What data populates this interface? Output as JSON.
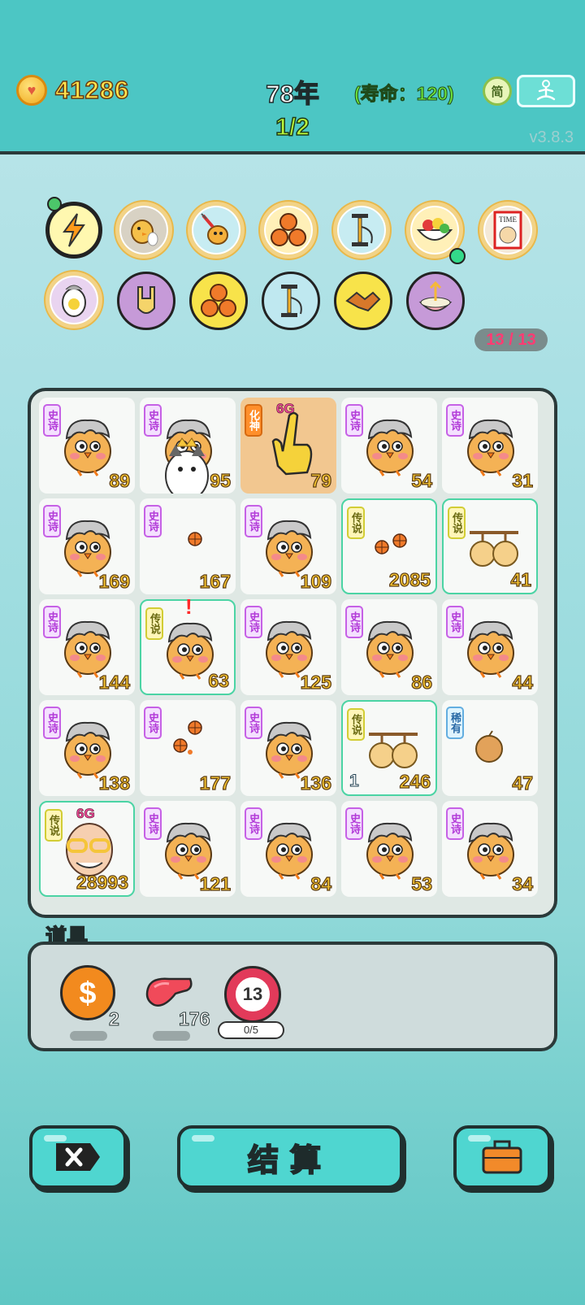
{
  "header": {
    "coins": "41286",
    "year": "78年",
    "lifespan": "(寿命：120)",
    "round": "1/2",
    "simplified_icon_label": "简",
    "version": "v3.8.3"
  },
  "buffs": {
    "count": "13 / 13",
    "row1": [
      "lightning-icon",
      "chick-egg-icon",
      "syringe-chick-icon",
      "basketballs-icon",
      "pump-icon",
      "fruit-bowl-icon",
      "time-magazine-icon"
    ],
    "row2": [
      "egg-head-icon",
      "rock-hand-icon",
      "basketballs-icon",
      "pump-icon",
      "handshake-icon",
      "upgrade-bowl-icon"
    ]
  },
  "board": {
    "cells": [
      {
        "tag": "史诗",
        "value": "89",
        "icon": "chicken-guy-icon"
      },
      {
        "tag": "史诗",
        "value": "95",
        "icon": "chicken-guy-husky-icon"
      },
      {
        "tag": "化神",
        "value": "79",
        "icon": "pointing-hand-icon",
        "badge": "6G"
      },
      {
        "tag": "史诗",
        "value": "54",
        "icon": "chicken-guy-icon"
      },
      {
        "tag": "史诗",
        "value": "31",
        "icon": "chicken-guy-icon"
      },
      {
        "tag": "史诗",
        "value": "169",
        "icon": "chicken-guy-icon"
      },
      {
        "tag": "史诗",
        "value": "167",
        "icon": "basketball-icon"
      },
      {
        "tag": "史诗",
        "value": "109",
        "icon": "chicken-guy-icon"
      },
      {
        "tag": "传说",
        "value": "2085",
        "icon": "basketball-icon"
      },
      {
        "tag": "传说",
        "value": "41",
        "icon": "gourd-icon"
      },
      {
        "tag": "史诗",
        "value": "144",
        "icon": "chicken-guy-icon"
      },
      {
        "tag": "传说",
        "value": "63",
        "icon": "chicken-guy-icon",
        "alert": "!"
      },
      {
        "tag": "史诗",
        "value": "125",
        "icon": "chicken-guy-icon"
      },
      {
        "tag": "史诗",
        "value": "86",
        "icon": "chicken-guy-icon"
      },
      {
        "tag": "史诗",
        "value": "44",
        "icon": "chicken-guy-icon"
      },
      {
        "tag": "史诗",
        "value": "138",
        "icon": "chicken-guy-icon"
      },
      {
        "tag": "史诗",
        "value": "177",
        "icon": "basketball-icon"
      },
      {
        "tag": "史诗",
        "value": "136",
        "icon": "chicken-guy-icon"
      },
      {
        "tag": "传说",
        "value": "246",
        "icon": "gourd-icon",
        "sub": "1"
      },
      {
        "tag": "稀有",
        "value": "47",
        "icon": "seed-icon"
      },
      {
        "tag": "传说",
        "value": "28993",
        "icon": "old-man-icon",
        "badge": "6G"
      },
      {
        "tag": "史诗",
        "value": "121",
        "icon": "chicken-guy-icon"
      },
      {
        "tag": "史诗",
        "value": "84",
        "icon": "chicken-guy-icon"
      },
      {
        "tag": "史诗",
        "value": "53",
        "icon": "chicken-guy-icon"
      },
      {
        "tag": "史诗",
        "value": "34",
        "icon": "chicken-guy-icon"
      }
    ]
  },
  "items": {
    "title": "道具",
    "coin_count": "2",
    "liver_count": "176",
    "target_value": "13",
    "target_progress": "0/5"
  },
  "actions": {
    "settle_label": "结算"
  },
  "colors": {
    "topbar": "#4cc6c4",
    "coin_text": "#ffe34d",
    "epic": "#c661e6",
    "legend": "#4bd4a4",
    "value_text": "#f5c431"
  }
}
